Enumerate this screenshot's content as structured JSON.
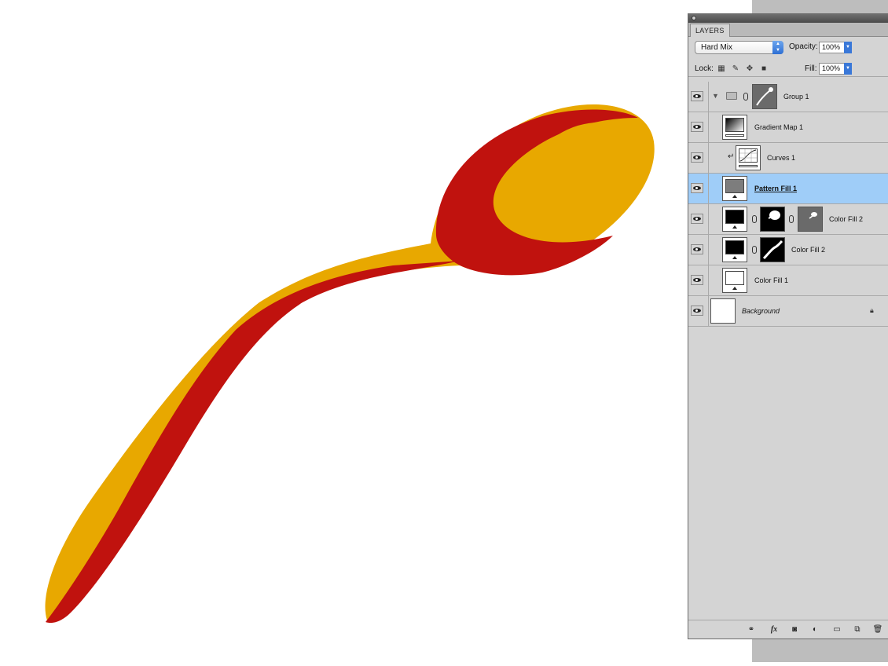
{
  "panel": {
    "tab_label": "LAYERS",
    "blend_mode": "Hard Mix",
    "opacity_label": "Opacity:",
    "opacity_value": "100%",
    "lock_label": "Lock:",
    "fill_label": "Fill:",
    "fill_value": "100%"
  },
  "layers": [
    {
      "name": "Group 1",
      "type": "group",
      "visible": true
    },
    {
      "name": "Gradient Map 1",
      "type": "adjustment",
      "visible": true
    },
    {
      "name": "Curves 1",
      "type": "adjustment-clipped",
      "visible": true
    },
    {
      "name": "Pattern Fill 1",
      "type": "fill",
      "visible": true,
      "selected": true
    },
    {
      "name": "Color Fill 2",
      "type": "fill-masked",
      "visible": true
    },
    {
      "name": "Color Fill 2",
      "type": "fill-masked",
      "visible": true
    },
    {
      "name": "Color Fill 1",
      "type": "fill",
      "visible": true
    },
    {
      "name": "Background",
      "type": "background",
      "visible": true,
      "locked": true
    }
  ],
  "bottom_icons": [
    "link-layers-icon",
    "fx-icon",
    "add-mask-icon",
    "adjustment-layer-icon",
    "new-group-icon",
    "new-layer-icon",
    "trash-icon"
  ],
  "colors": {
    "spoon_yellow": "#e8a800",
    "spoon_red": "#c0120e",
    "selection_blue": "#9fcdf8",
    "panel_gray": "#d4d4d4"
  }
}
